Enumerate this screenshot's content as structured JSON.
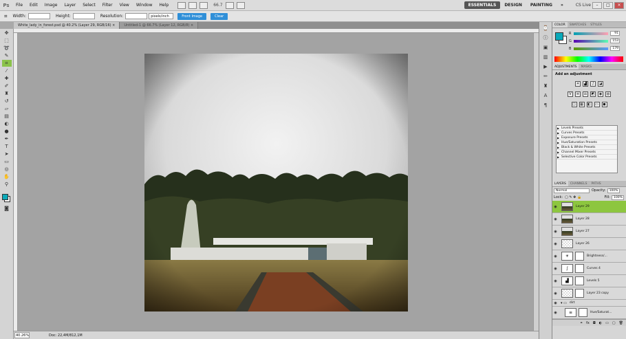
{
  "app": {
    "logo": "Ps"
  },
  "menu": [
    "File",
    "Edit",
    "Image",
    "Layer",
    "Select",
    "Filter",
    "View",
    "Window",
    "Help"
  ],
  "menu_zoom": "66.7",
  "workspaces": {
    "essentials": "ESSENTIALS",
    "design": "DESIGN",
    "painting": "PAINTING",
    "more": "»",
    "cslive": "CS Live"
  },
  "options": {
    "width_label": "Width:",
    "height_label": "Height:",
    "resolution_label": "Resolution:",
    "units": "pixels/inch",
    "front_image": "Front Image",
    "clear": "Clear"
  },
  "tabs": [
    {
      "label": "White_lady_in_forest.psd @ 40.2% (Layer 29, RGB/16) ×"
    },
    {
      "label": "Untitled-1 @ 66.7% (Layer 12, RGB/8) ×"
    }
  ],
  "status": {
    "zoom": "40.26%",
    "doc": "Doc: 22,4M/812,1M"
  },
  "color_panel": {
    "tabs": [
      "COLOR",
      "SWATCHES",
      "STYLES"
    ],
    "r": "91",
    "g": "153",
    "b": "179",
    "fg_color": "#0aa9b9"
  },
  "adjustments": {
    "tabs": [
      "ADJUSTMENTS",
      "MASKS"
    ],
    "title": "Add an adjustment",
    "presets": [
      "Levels Presets",
      "Curves Presets",
      "Exposure Presets",
      "Hue/Saturation Presets",
      "Black & White Presets",
      "Channel Mixer Presets",
      "Selective Color Presets"
    ]
  },
  "layers_panel": {
    "tabs": [
      "LAYERS",
      "CHANNELS",
      "PATHS"
    ],
    "blend_mode": "Normal",
    "opacity_label": "Opacity:",
    "opacity": "100%",
    "lock_label": "Lock:",
    "fill_label": "Fill:",
    "fill": "100%",
    "layers": [
      {
        "name": "Layer 29"
      },
      {
        "name": "Layer 28"
      },
      {
        "name": "Layer 27"
      },
      {
        "name": "Layer 26"
      },
      {
        "name": "Brightness/..."
      },
      {
        "name": "Curves 4"
      },
      {
        "name": "Levels 5"
      },
      {
        "name": "Layer 23 copy"
      },
      {
        "name": "dirt"
      },
      {
        "name": "Hue/Saturat..."
      }
    ]
  }
}
